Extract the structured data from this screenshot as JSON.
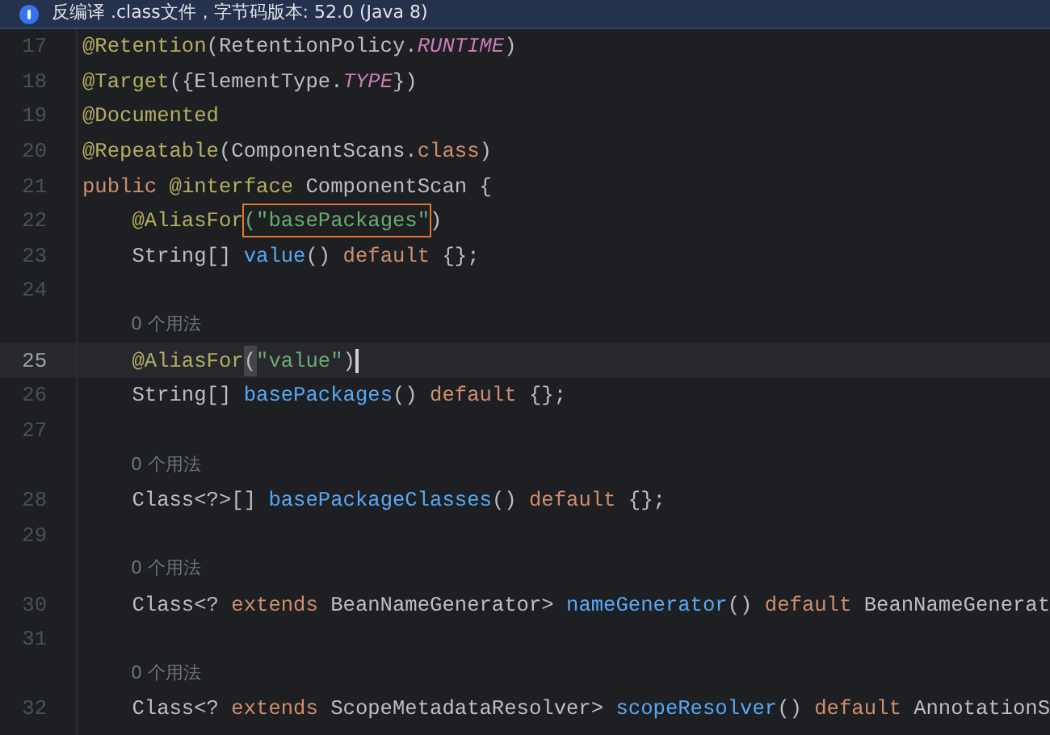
{
  "banner": {
    "text": "反编译 .class文件，字节码版本: 52.0 (Java 8)"
  },
  "lines": [
    {
      "kind": "code",
      "number": "17",
      "current": false,
      "tokens": [
        {
          "kind": "annotation",
          "t": "@Retention"
        },
        {
          "kind": "plain",
          "t": "(RetentionPolicy."
        },
        {
          "kind": "constant",
          "t": "RUNTIME"
        },
        {
          "kind": "plain",
          "t": ")"
        }
      ]
    },
    {
      "kind": "code",
      "number": "18",
      "current": false,
      "tokens": [
        {
          "kind": "annotation",
          "t": "@Target"
        },
        {
          "kind": "plain",
          "t": "({ElementType."
        },
        {
          "kind": "constant",
          "t": "TYPE"
        },
        {
          "kind": "plain",
          "t": "})"
        }
      ]
    },
    {
      "kind": "code",
      "number": "19",
      "current": false,
      "tokens": [
        {
          "kind": "annotation",
          "t": "@Documented"
        }
      ]
    },
    {
      "kind": "code",
      "number": "20",
      "current": false,
      "tokens": [
        {
          "kind": "annotation",
          "t": "@Repeatable"
        },
        {
          "kind": "plain",
          "t": "(ComponentScans."
        },
        {
          "kind": "keyword",
          "t": "class"
        },
        {
          "kind": "plain",
          "t": ")"
        }
      ]
    },
    {
      "kind": "code",
      "number": "21",
      "current": false,
      "tokens": [
        {
          "kind": "keyword",
          "t": "public "
        },
        {
          "kind": "annotation",
          "t": "@interface "
        },
        {
          "kind": "plain",
          "t": "ComponentScan {"
        }
      ]
    },
    {
      "kind": "code",
      "number": "22",
      "current": false,
      "tokens": [
        {
          "kind": "annotation",
          "t": "    @AliasFor"
        },
        {
          "kind": "boxed",
          "t": "(\"basePackages\""
        },
        {
          "kind": "plain",
          "t": ")"
        }
      ]
    },
    {
      "kind": "code",
      "number": "23",
      "current": false,
      "tokens": [
        {
          "kind": "plain",
          "t": "    String[] "
        },
        {
          "kind": "method",
          "t": "value"
        },
        {
          "kind": "plain",
          "t": "() "
        },
        {
          "kind": "keyword",
          "t": "default "
        },
        {
          "kind": "plain",
          "t": "{};"
        }
      ]
    },
    {
      "kind": "code",
      "number": "24",
      "current": false
    },
    {
      "kind": "hint",
      "text": "0 个用法"
    },
    {
      "kind": "code",
      "number": "25",
      "current": true,
      "tokens": [
        {
          "kind": "annotation",
          "t": "    @AliasFor"
        },
        {
          "kind": "match",
          "t": "("
        },
        {
          "kind": "string",
          "t": "\"value\""
        },
        {
          "kind": "plain",
          "t": ")"
        }
      ]
    },
    {
      "kind": "code",
      "number": "26",
      "current": false,
      "tokens": [
        {
          "kind": "plain",
          "t": "    String[] "
        },
        {
          "kind": "method",
          "t": "basePackages"
        },
        {
          "kind": "plain",
          "t": "() "
        },
        {
          "kind": "keyword",
          "t": "default "
        },
        {
          "kind": "plain",
          "t": "{};"
        }
      ]
    },
    {
      "kind": "code",
      "number": "27",
      "current": false
    },
    {
      "kind": "hint",
      "text": "0 个用法"
    },
    {
      "kind": "code",
      "number": "28",
      "current": false,
      "tokens": [
        {
          "kind": "plain",
          "t": "    Class<?>[] "
        },
        {
          "kind": "method",
          "t": "basePackageClasses"
        },
        {
          "kind": "plain",
          "t": "() "
        },
        {
          "kind": "keyword",
          "t": "default "
        },
        {
          "kind": "plain",
          "t": "{};"
        }
      ]
    },
    {
      "kind": "code",
      "number": "29",
      "current": false
    },
    {
      "kind": "hint",
      "text": "0 个用法"
    },
    {
      "kind": "code",
      "number": "30",
      "current": false,
      "tokens": [
        {
          "kind": "plain",
          "t": "    Class<? "
        },
        {
          "kind": "keyword",
          "t": "extends "
        },
        {
          "kind": "plain",
          "t": "BeanNameGenerator> "
        },
        {
          "kind": "method",
          "t": "nameGenerator"
        },
        {
          "kind": "plain",
          "t": "() "
        },
        {
          "kind": "keyword",
          "t": "default "
        },
        {
          "kind": "plain",
          "t": "BeanNameGenerat"
        }
      ]
    },
    {
      "kind": "code",
      "number": "31",
      "current": false
    },
    {
      "kind": "hint",
      "text": "0 个用法"
    },
    {
      "kind": "code",
      "number": "32",
      "current": false,
      "tokens": [
        {
          "kind": "plain",
          "t": "    Class<? "
        },
        {
          "kind": "keyword",
          "t": "extends "
        },
        {
          "kind": "plain",
          "t": "ScopeMetadataResolver> "
        },
        {
          "kind": "method",
          "t": "scopeResolver"
        },
        {
          "kind": "plain",
          "t": "() "
        },
        {
          "kind": "keyword",
          "t": "default "
        },
        {
          "kind": "plain",
          "t": "AnnotationS"
        }
      ]
    }
  ]
}
